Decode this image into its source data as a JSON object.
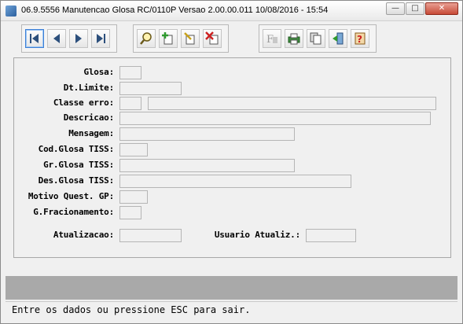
{
  "window": {
    "title": "06.9.5556 Manutencao  Glosa RC/0110P Versao 2.00.00.011 10/08/2016 - 15:54"
  },
  "toolbar": {
    "nav": [
      "first-record-icon",
      "previous-record-icon",
      "next-record-icon",
      "last-record-icon"
    ],
    "edit": [
      "search-icon",
      "add-record-icon",
      "edit-record-icon",
      "delete-record-icon"
    ],
    "misc": [
      "filter-icon",
      "print-icon",
      "copy-icon",
      "exit-door-icon",
      "help-icon"
    ]
  },
  "form": {
    "glosa": {
      "label": "Glosa:",
      "value": ""
    },
    "dt_limite": {
      "label": "Dt.Limite:",
      "value": ""
    },
    "classe_erro": {
      "label": "Classe erro:",
      "code": "",
      "description": ""
    },
    "descricao": {
      "label": "Descricao:",
      "value": ""
    },
    "mensagem": {
      "label": "Mensagem:",
      "value": ""
    },
    "cod_glosa_tiss": {
      "label": "Cod.Glosa TISS:",
      "value": ""
    },
    "gr_glosa_tiss": {
      "label": "Gr.Glosa TISS:",
      "value": ""
    },
    "des_glosa_tiss": {
      "label": "Des.Glosa TISS:",
      "value": ""
    },
    "motivo_quest_gp": {
      "label": "Motivo Quest. GP:",
      "value": ""
    },
    "g_fracionamento": {
      "label": "G.Fracionamento:",
      "value": ""
    },
    "atualizacao": {
      "label": "Atualizacao:",
      "value": ""
    },
    "usuario_atualiz": {
      "label": "Usuario Atualiz.:",
      "value": ""
    }
  },
  "status": {
    "message": "Entre os dados ou pressione ESC para sair."
  }
}
